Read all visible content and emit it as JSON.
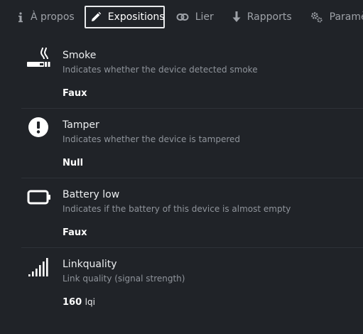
{
  "tabs": [
    {
      "label": "À propos",
      "icon": "info-icon"
    },
    {
      "label": "Expositions",
      "icon": "pencil-icon",
      "active": true
    },
    {
      "label": "Lier",
      "icon": "link-icon"
    },
    {
      "label": "Rapports",
      "icon": "arrow-down-icon"
    },
    {
      "label": "Paramètres",
      "icon": "gears-icon"
    }
  ],
  "exposes": [
    {
      "icon": "smoking-icon",
      "title": "Smoke",
      "description": "Indicates whether the device detected smoke",
      "value": "Faux",
      "unit": ""
    },
    {
      "icon": "exclamation-circle-icon",
      "title": "Tamper",
      "description": "Indicates whether the device is tampered",
      "value": "Null",
      "unit": ""
    },
    {
      "icon": "battery-empty-icon",
      "title": "Battery low",
      "description": "Indicates if the battery of this device is almost empty",
      "value": "Faux",
      "unit": ""
    },
    {
      "icon": "signal-icon",
      "title": "Linkquality",
      "description": "Link quality (signal strength)",
      "value": "160",
      "unit": "lqi"
    }
  ],
  "colors": {
    "background": "#202328",
    "text": "#e9eaec",
    "muted": "#8f949b",
    "divider": "#2e3238"
  }
}
